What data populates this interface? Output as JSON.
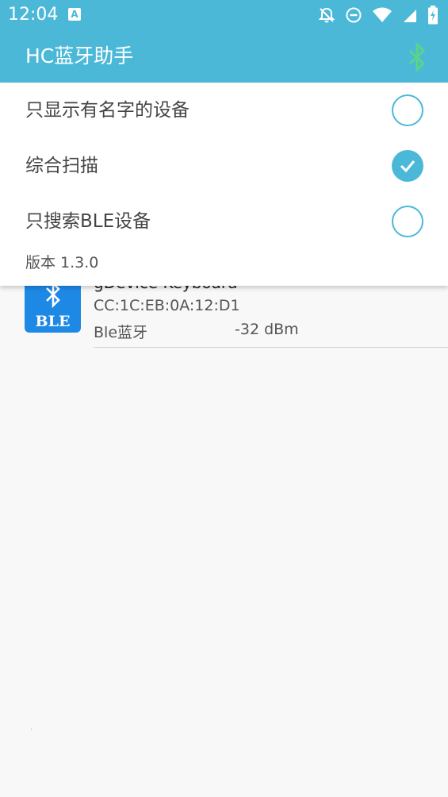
{
  "status_bar": {
    "time": "12:04",
    "a_icon_letter": "A",
    "icons": [
      "notifications-off-icon",
      "do-not-disturb-icon",
      "wifi-icon",
      "cellular-signal-icon",
      "battery-charging-icon"
    ]
  },
  "app_bar": {
    "title": "HC蓝牙助手",
    "action_icon": "bluetooth-icon",
    "color": "#4cb8d8",
    "action_icon_color": "#5ad48a"
  },
  "menu": {
    "items": [
      {
        "label": "只显示有名字的设备",
        "checked": false
      },
      {
        "label": "综合扫描",
        "checked": true
      },
      {
        "label": "只搜索BLE设备",
        "checked": false
      }
    ],
    "version": "版本 1.3.0"
  },
  "device_list": {
    "items": [
      {
        "icon": "ble-logo-icon",
        "logo_text": "BLE",
        "name": "gDevice Keyboard",
        "mac": "CC:1C:EB:0A:12:D1",
        "type": "Ble蓝牙",
        "rssi": "-32 dBm"
      }
    ]
  }
}
